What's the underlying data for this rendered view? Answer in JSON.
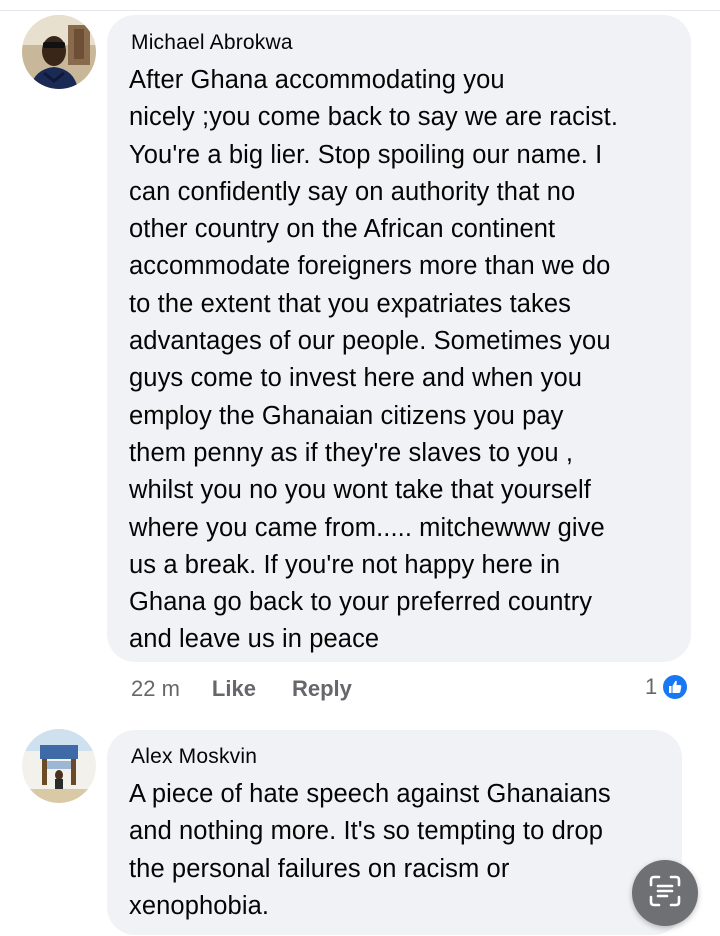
{
  "comments": [
    {
      "author": "Michael Abrokwa",
      "text": "After Ghana accommodating you\nnicely ;you come back to say we are racist.\nYou're a big lier.  Stop spoiling our name. I\ncan confidently say on authority that no\nother country on the African continent\naccommodate foreigners more than we do\nto the extent that you expatriates takes\nadvantages of our people. Sometimes you\nguys come to invest here and when you\nemploy the Ghanaian citizens you pay\nthem penny as if they're slaves to you ,\nwhilst you no you wont take that yourself\nwhere you came from..... mitchewww give\nus a break. If you're not happy here in\nGhana go back to your preferred country\nand leave us in peace",
      "time": "22 m",
      "like_label": "Like",
      "reply_label": "Reply",
      "reaction_count": "1",
      "reaction_icon": "thumbs-up-icon"
    },
    {
      "author": "Alex Moskvin",
      "text": "A piece of hate speech against Ghanaians\nand nothing more. It's so tempting to drop\nthe personal failures on racism or\nxenophobia."
    }
  ],
  "floating_button": {
    "icon": "scan-text-icon"
  },
  "colors": {
    "bubble": "#f0f2f5",
    "secondary_text": "#65676b",
    "like_blue": "#1877f2",
    "fab": "#6f7073"
  }
}
